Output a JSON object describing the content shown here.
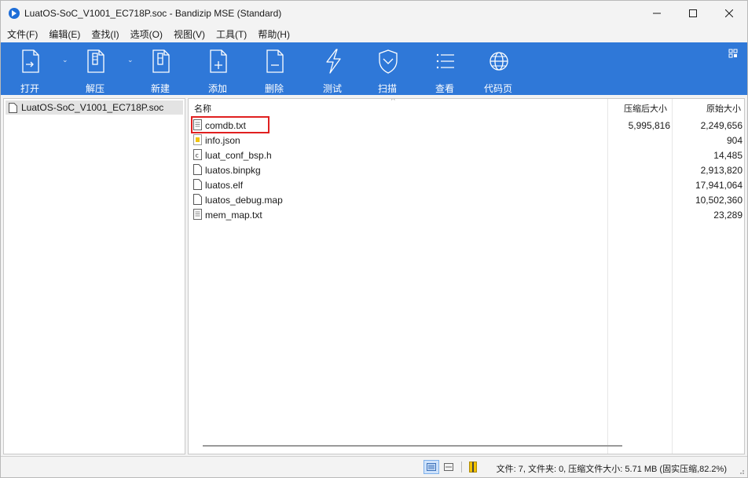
{
  "window": {
    "title": "LuatOS-SoC_V1001_EC718P.soc - Bandizip MSE (Standard)",
    "controls": [
      "minimize-icon",
      "maximize-icon",
      "close-icon"
    ],
    "accent": "#2f78d8"
  },
  "menu": [
    "文件(F)",
    "编辑(E)",
    "查找(I)",
    "选项(O)",
    "视图(V)",
    "工具(T)",
    "帮助(H)"
  ],
  "toolbar": {
    "open": "打开",
    "extract": "解压",
    "new": "新建",
    "add": "添加",
    "delete": "删除",
    "test": "测试",
    "scan": "扫描",
    "view": "查看",
    "codepage": "代码页"
  },
  "tree": {
    "root": "LuatOS-SoC_V1001_EC718P.soc"
  },
  "columns": {
    "name": "名称",
    "compressed": "压缩后大小",
    "original": "原始大小"
  },
  "files": [
    {
      "name": "comdb.txt",
      "compressed": "5,995,816",
      "original": "2,249,656",
      "icon": "text-file-icon"
    },
    {
      "name": "info.json",
      "compressed": "",
      "original": "904",
      "icon": "json-file-icon"
    },
    {
      "name": "luat_conf_bsp.h",
      "compressed": "",
      "original": "14,485",
      "icon": "c-header-file-icon"
    },
    {
      "name": "luatos.binpkg",
      "compressed": "",
      "original": "2,913,820",
      "icon": "blank-file-icon"
    },
    {
      "name": "luatos.elf",
      "compressed": "",
      "original": "17,941,064",
      "icon": "blank-file-icon"
    },
    {
      "name": "luatos_debug.map",
      "compressed": "",
      "original": "10,502,360",
      "icon": "blank-file-icon"
    },
    {
      "name": "mem_map.txt",
      "compressed": "",
      "original": "23,289",
      "icon": "text-file-icon"
    }
  ],
  "status": {
    "text": "文件: 7, 文件夹: 0, 压缩文件大小: 5.71 MB (固实压缩,82.2%)"
  }
}
